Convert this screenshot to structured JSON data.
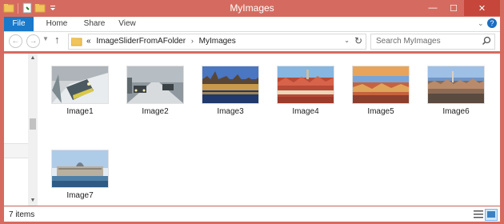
{
  "window": {
    "title": "MyImages",
    "title_color": "#d56b60",
    "buttons": {
      "minimize": "—",
      "maximize": "☐",
      "close": "✕"
    }
  },
  "ribbon": {
    "tabs": [
      "File",
      "Home",
      "Share",
      "View"
    ],
    "file_tab_color": "#1979ca"
  },
  "navigation": {
    "back_icon": "back-arrow-icon",
    "forward_icon": "forward-arrow-icon",
    "up_icon": "up-arrow-icon",
    "breadcrumb": [
      "«",
      "ImageSliderFromAFolder",
      "MyImages"
    ],
    "search_placeholder": "Search MyImages"
  },
  "files": [
    {
      "name": "Image1",
      "scene": "snowy train"
    },
    {
      "name": "Image2",
      "scene": "snowy road with cars"
    },
    {
      "name": "Image3",
      "scene": "city at dusk"
    },
    {
      "name": "Image4",
      "scene": "red rooftops"
    },
    {
      "name": "Image5",
      "scene": "city rooftops"
    },
    {
      "name": "Image6",
      "scene": "city skyline"
    },
    {
      "name": "Image7",
      "scene": "domed building"
    }
  ],
  "status": {
    "item_count": "7 items"
  }
}
